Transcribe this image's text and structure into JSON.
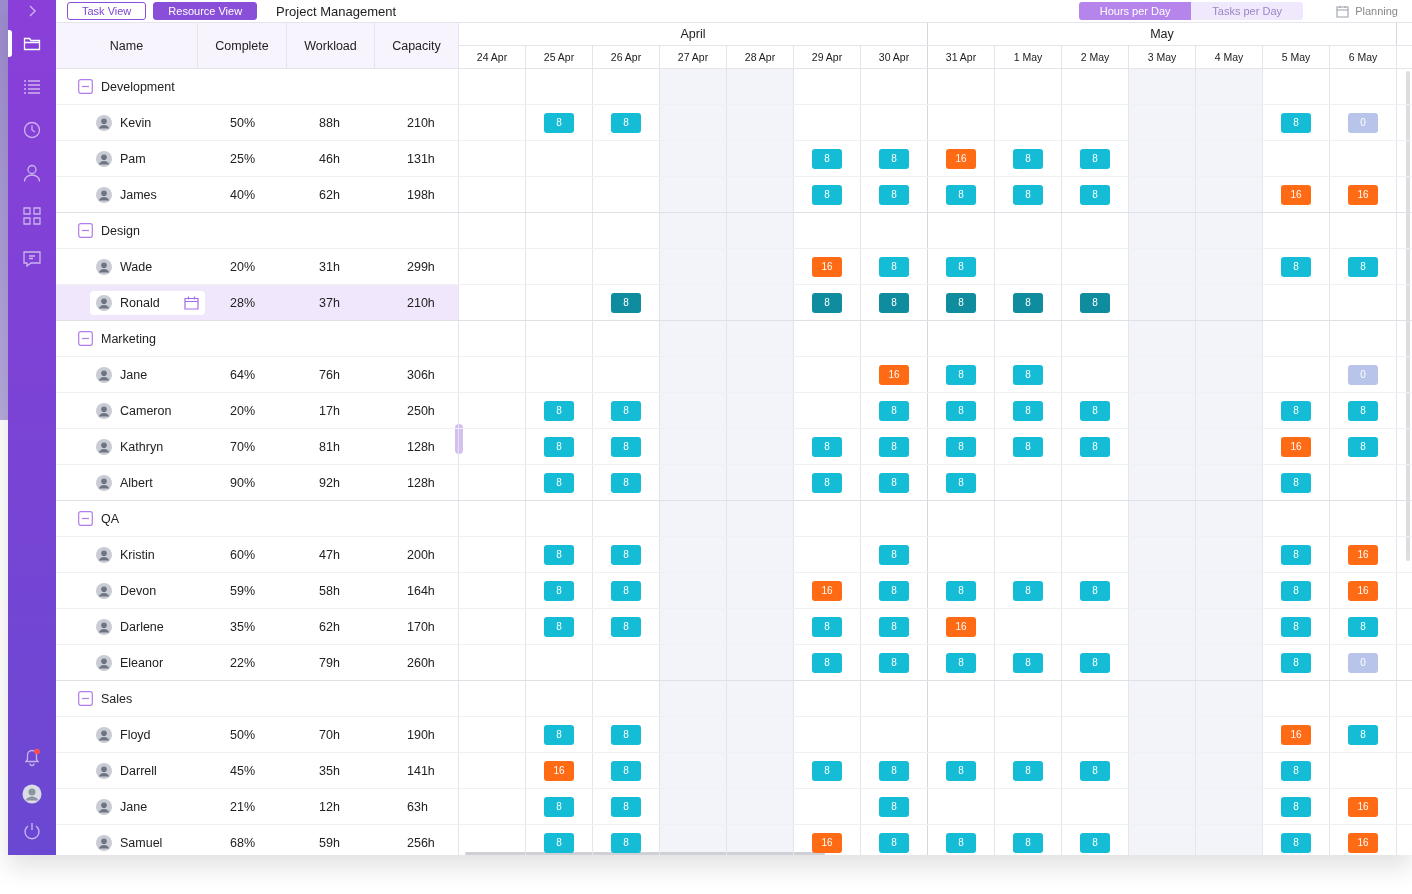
{
  "toolbar": {
    "view_buttons": [
      {
        "label": "Task View",
        "selected": false
      },
      {
        "label": "Resource View",
        "selected": true
      }
    ],
    "title": "Project Management",
    "mode_tabs": [
      {
        "label": "Hours per Day",
        "selected": true
      },
      {
        "label": "Tasks per Day",
        "selected": false
      }
    ],
    "planning_label": "Planning"
  },
  "sidebar": {
    "top_items": [
      {
        "kind": "chevron",
        "selected": false
      },
      {
        "kind": "folder",
        "selected": true
      },
      {
        "kind": "list",
        "selected": false
      },
      {
        "kind": "clock",
        "selected": false
      },
      {
        "kind": "user",
        "selected": false
      },
      {
        "kind": "grid",
        "selected": false
      },
      {
        "kind": "chat",
        "selected": false
      }
    ],
    "bottom_items": [
      {
        "kind": "bell",
        "badge": true
      },
      {
        "kind": "avatar",
        "badge": false
      },
      {
        "kind": "power",
        "badge": false
      }
    ]
  },
  "table": {
    "columns": [
      "Name",
      "Complete",
      "Workload",
      "Capacity"
    ]
  },
  "timeline": {
    "months": [
      {
        "label": "April",
        "days": [
          {
            "label": "24 Apr",
            "weekend": false
          },
          {
            "label": "25 Apr",
            "weekend": false
          },
          {
            "label": "26 Apr",
            "weekend": false
          },
          {
            "label": "27 Apr",
            "weekend": true
          },
          {
            "label": "28 Apr",
            "weekend": true
          },
          {
            "label": "29 Apr",
            "weekend": false
          },
          {
            "label": "30 Apr",
            "weekend": false
          }
        ]
      },
      {
        "label": "May",
        "days": [
          {
            "label": "31 Apr",
            "weekend": false
          },
          {
            "label": "1 May",
            "weekend": false
          },
          {
            "label": "2 May",
            "weekend": false
          },
          {
            "label": "3 May",
            "weekend": true
          },
          {
            "label": "4 May",
            "weekend": true
          },
          {
            "label": "5 May",
            "weekend": false
          },
          {
            "label": "6 May",
            "weekend": false
          }
        ]
      }
    ]
  },
  "groups": [
    {
      "name": "Development",
      "expanded": true,
      "people": [
        {
          "name": "Kevin",
          "complete": "50%",
          "workload": "88h",
          "capacity": "210h",
          "selected": false,
          "cells": [
            {
              "kind": "empty"
            },
            {
              "kind": "normal",
              "hours": "8"
            },
            {
              "kind": "normal",
              "hours": "8"
            },
            {
              "kind": "empty"
            },
            {
              "kind": "empty"
            },
            {
              "kind": "empty"
            },
            {
              "kind": "empty"
            },
            {
              "kind": "empty"
            },
            {
              "kind": "empty"
            },
            {
              "kind": "empty"
            },
            {
              "kind": "empty"
            },
            {
              "kind": "empty"
            },
            {
              "kind": "normal",
              "hours": "8"
            },
            {
              "kind": "zero",
              "hours": "0"
            }
          ]
        },
        {
          "name": "Pam",
          "complete": "25%",
          "workload": "46h",
          "capacity": "131h",
          "selected": false,
          "cells": [
            {
              "kind": "empty"
            },
            {
              "kind": "empty"
            },
            {
              "kind": "empty"
            },
            {
              "kind": "empty"
            },
            {
              "kind": "empty"
            },
            {
              "kind": "normal",
              "hours": "8"
            },
            {
              "kind": "normal",
              "hours": "8"
            },
            {
              "kind": "over",
              "hours": "16"
            },
            {
              "kind": "normal",
              "hours": "8"
            },
            {
              "kind": "normal",
              "hours": "8"
            },
            {
              "kind": "empty"
            },
            {
              "kind": "empty"
            },
            {
              "kind": "empty"
            },
            {
              "kind": "empty"
            }
          ]
        },
        {
          "name": "James",
          "complete": "40%",
          "workload": "62h",
          "capacity": "198h",
          "selected": false,
          "cells": [
            {
              "kind": "empty"
            },
            {
              "kind": "empty"
            },
            {
              "kind": "empty"
            },
            {
              "kind": "empty"
            },
            {
              "kind": "empty"
            },
            {
              "kind": "normal",
              "hours": "8"
            },
            {
              "kind": "normal",
              "hours": "8"
            },
            {
              "kind": "normal",
              "hours": "8"
            },
            {
              "kind": "normal",
              "hours": "8"
            },
            {
              "kind": "normal",
              "hours": "8"
            },
            {
              "kind": "empty"
            },
            {
              "kind": "empty"
            },
            {
              "kind": "over",
              "hours": "16"
            },
            {
              "kind": "over",
              "hours": "16"
            }
          ]
        }
      ]
    },
    {
      "name": "Design",
      "expanded": true,
      "people": [
        {
          "name": "Wade",
          "complete": "20%",
          "workload": "31h",
          "capacity": "299h",
          "selected": false,
          "cells": [
            {
              "kind": "empty"
            },
            {
              "kind": "empty"
            },
            {
              "kind": "empty"
            },
            {
              "kind": "empty"
            },
            {
              "kind": "empty"
            },
            {
              "kind": "over",
              "hours": "16"
            },
            {
              "kind": "normal",
              "hours": "8"
            },
            {
              "kind": "normal",
              "hours": "8"
            },
            {
              "kind": "empty"
            },
            {
              "kind": "empty"
            },
            {
              "kind": "empty"
            },
            {
              "kind": "empty"
            },
            {
              "kind": "normal",
              "hours": "8"
            },
            {
              "kind": "normal",
              "hours": "8"
            }
          ]
        },
        {
          "name": "Ronald",
          "complete": "28%",
          "workload": "37h",
          "capacity": "210h",
          "selected": true,
          "cells": [
            {
              "kind": "empty"
            },
            {
              "kind": "empty"
            },
            {
              "kind": "normal",
              "hours": "8"
            },
            {
              "kind": "empty"
            },
            {
              "kind": "empty"
            },
            {
              "kind": "normal",
              "hours": "8"
            },
            {
              "kind": "normal",
              "hours": "8"
            },
            {
              "kind": "normal",
              "hours": "8"
            },
            {
              "kind": "normal",
              "hours": "8"
            },
            {
              "kind": "normal",
              "hours": "8"
            },
            {
              "kind": "empty"
            },
            {
              "kind": "empty"
            },
            {
              "kind": "empty"
            },
            {
              "kind": "empty"
            }
          ]
        }
      ]
    },
    {
      "name": "Marketing",
      "expanded": true,
      "people": [
        {
          "name": "Jane",
          "complete": "64%",
          "workload": "76h",
          "capacity": "306h",
          "selected": false,
          "cells": [
            {
              "kind": "empty"
            },
            {
              "kind": "empty"
            },
            {
              "kind": "empty"
            },
            {
              "kind": "empty"
            },
            {
              "kind": "empty"
            },
            {
              "kind": "empty"
            },
            {
              "kind": "over",
              "hours": "16"
            },
            {
              "kind": "normal",
              "hours": "8"
            },
            {
              "kind": "normal",
              "hours": "8"
            },
            {
              "kind": "empty"
            },
            {
              "kind": "empty"
            },
            {
              "kind": "empty"
            },
            {
              "kind": "empty"
            },
            {
              "kind": "zero",
              "hours": "0"
            }
          ]
        },
        {
          "name": "Cameron",
          "complete": "20%",
          "workload": "17h",
          "capacity": "250h",
          "selected": false,
          "cells": [
            {
              "kind": "empty"
            },
            {
              "kind": "normal",
              "hours": "8"
            },
            {
              "kind": "normal",
              "hours": "8"
            },
            {
              "kind": "empty"
            },
            {
              "kind": "empty"
            },
            {
              "kind": "empty"
            },
            {
              "kind": "normal",
              "hours": "8"
            },
            {
              "kind": "normal",
              "hours": "8"
            },
            {
              "kind": "normal",
              "hours": "8"
            },
            {
              "kind": "normal",
              "hours": "8"
            },
            {
              "kind": "empty"
            },
            {
              "kind": "empty"
            },
            {
              "kind": "normal",
              "hours": "8"
            },
            {
              "kind": "normal",
              "hours": "8"
            }
          ]
        },
        {
          "name": "Kathryn",
          "complete": "70%",
          "workload": "81h",
          "capacity": "128h",
          "selected": false,
          "cells": [
            {
              "kind": "empty"
            },
            {
              "kind": "normal",
              "hours": "8"
            },
            {
              "kind": "normal",
              "hours": "8"
            },
            {
              "kind": "empty"
            },
            {
              "kind": "empty"
            },
            {
              "kind": "normal",
              "hours": "8"
            },
            {
              "kind": "normal",
              "hours": "8"
            },
            {
              "kind": "normal",
              "hours": "8"
            },
            {
              "kind": "normal",
              "hours": "8"
            },
            {
              "kind": "normal",
              "hours": "8"
            },
            {
              "kind": "empty"
            },
            {
              "kind": "empty"
            },
            {
              "kind": "over",
              "hours": "16"
            },
            {
              "kind": "normal",
              "hours": "8"
            }
          ]
        },
        {
          "name": "Albert",
          "complete": "90%",
          "workload": "92h",
          "capacity": "128h",
          "selected": false,
          "cells": [
            {
              "kind": "empty"
            },
            {
              "kind": "normal",
              "hours": "8"
            },
            {
              "kind": "normal",
              "hours": "8"
            },
            {
              "kind": "empty"
            },
            {
              "kind": "empty"
            },
            {
              "kind": "normal",
              "hours": "8"
            },
            {
              "kind": "normal",
              "hours": "8"
            },
            {
              "kind": "normal",
              "hours": "8"
            },
            {
              "kind": "empty"
            },
            {
              "kind": "empty"
            },
            {
              "kind": "empty"
            },
            {
              "kind": "empty"
            },
            {
              "kind": "normal",
              "hours": "8"
            },
            {
              "kind": "empty"
            }
          ]
        }
      ]
    },
    {
      "name": "QA",
      "expanded": true,
      "people": [
        {
          "name": "Kristin",
          "complete": "60%",
          "workload": "47h",
          "capacity": "200h",
          "selected": false,
          "cells": [
            {
              "kind": "empty"
            },
            {
              "kind": "normal",
              "hours": "8"
            },
            {
              "kind": "normal",
              "hours": "8"
            },
            {
              "kind": "empty"
            },
            {
              "kind": "empty"
            },
            {
              "kind": "empty"
            },
            {
              "kind": "normal",
              "hours": "8"
            },
            {
              "kind": "empty"
            },
            {
              "kind": "empty"
            },
            {
              "kind": "empty"
            },
            {
              "kind": "empty"
            },
            {
              "kind": "empty"
            },
            {
              "kind": "normal",
              "hours": "8"
            },
            {
              "kind": "over",
              "hours": "16"
            }
          ]
        },
        {
          "name": "Devon",
          "complete": "59%",
          "workload": "58h",
          "capacity": "164h",
          "selected": false,
          "cells": [
            {
              "kind": "empty"
            },
            {
              "kind": "normal",
              "hours": "8"
            },
            {
              "kind": "normal",
              "hours": "8"
            },
            {
              "kind": "empty"
            },
            {
              "kind": "empty"
            },
            {
              "kind": "over",
              "hours": "16"
            },
            {
              "kind": "normal",
              "hours": "8"
            },
            {
              "kind": "normal",
              "hours": "8"
            },
            {
              "kind": "normal",
              "hours": "8"
            },
            {
              "kind": "normal",
              "hours": "8"
            },
            {
              "kind": "empty"
            },
            {
              "kind": "empty"
            },
            {
              "kind": "normal",
              "hours": "8"
            },
            {
              "kind": "over",
              "hours": "16"
            }
          ]
        },
        {
          "name": "Darlene",
          "complete": "35%",
          "workload": "62h",
          "capacity": "170h",
          "selected": false,
          "cells": [
            {
              "kind": "empty"
            },
            {
              "kind": "normal",
              "hours": "8"
            },
            {
              "kind": "normal",
              "hours": "8"
            },
            {
              "kind": "empty"
            },
            {
              "kind": "empty"
            },
            {
              "kind": "normal",
              "hours": "8"
            },
            {
              "kind": "normal",
              "hours": "8"
            },
            {
              "kind": "over",
              "hours": "16"
            },
            {
              "kind": "empty"
            },
            {
              "kind": "empty"
            },
            {
              "kind": "empty"
            },
            {
              "kind": "empty"
            },
            {
              "kind": "normal",
              "hours": "8"
            },
            {
              "kind": "normal",
              "hours": "8"
            }
          ]
        },
        {
          "name": "Eleanor",
          "complete": "22%",
          "workload": "79h",
          "capacity": "260h",
          "selected": false,
          "cells": [
            {
              "kind": "empty"
            },
            {
              "kind": "empty"
            },
            {
              "kind": "empty"
            },
            {
              "kind": "empty"
            },
            {
              "kind": "empty"
            },
            {
              "kind": "normal",
              "hours": "8"
            },
            {
              "kind": "normal",
              "hours": "8"
            },
            {
              "kind": "normal",
              "hours": "8"
            },
            {
              "kind": "normal",
              "hours": "8"
            },
            {
              "kind": "normal",
              "hours": "8"
            },
            {
              "kind": "empty"
            },
            {
              "kind": "empty"
            },
            {
              "kind": "normal",
              "hours": "8"
            },
            {
              "kind": "zero",
              "hours": "0"
            }
          ]
        }
      ]
    },
    {
      "name": "Sales",
      "expanded": true,
      "people": [
        {
          "name": "Floyd",
          "complete": "50%",
          "workload": "70h",
          "capacity": "190h",
          "selected": false,
          "cells": [
            {
              "kind": "empty"
            },
            {
              "kind": "normal",
              "hours": "8"
            },
            {
              "kind": "normal",
              "hours": "8"
            },
            {
              "kind": "empty"
            },
            {
              "kind": "empty"
            },
            {
              "kind": "empty"
            },
            {
              "kind": "empty"
            },
            {
              "kind": "empty"
            },
            {
              "kind": "empty"
            },
            {
              "kind": "empty"
            },
            {
              "kind": "empty"
            },
            {
              "kind": "empty"
            },
            {
              "kind": "over",
              "hours": "16"
            },
            {
              "kind": "normal",
              "hours": "8"
            }
          ]
        },
        {
          "name": "Darrell",
          "complete": "45%",
          "workload": "35h",
          "capacity": "141h",
          "selected": false,
          "cells": [
            {
              "kind": "empty"
            },
            {
              "kind": "over",
              "hours": "16"
            },
            {
              "kind": "normal",
              "hours": "8"
            },
            {
              "kind": "empty"
            },
            {
              "kind": "empty"
            },
            {
              "kind": "normal",
              "hours": "8"
            },
            {
              "kind": "normal",
              "hours": "8"
            },
            {
              "kind": "normal",
              "hours": "8"
            },
            {
              "kind": "normal",
              "hours": "8"
            },
            {
              "kind": "normal",
              "hours": "8"
            },
            {
              "kind": "empty"
            },
            {
              "kind": "empty"
            },
            {
              "kind": "normal",
              "hours": "8"
            },
            {
              "kind": "empty"
            }
          ]
        },
        {
          "name": "Jane",
          "complete": "21%",
          "workload": "12h",
          "capacity": "63h",
          "selected": false,
          "cells": [
            {
              "kind": "empty"
            },
            {
              "kind": "normal",
              "hours": "8"
            },
            {
              "kind": "normal",
              "hours": "8"
            },
            {
              "kind": "empty"
            },
            {
              "kind": "empty"
            },
            {
              "kind": "empty"
            },
            {
              "kind": "normal",
              "hours": "8"
            },
            {
              "kind": "empty"
            },
            {
              "kind": "empty"
            },
            {
              "kind": "empty"
            },
            {
              "kind": "empty"
            },
            {
              "kind": "empty"
            },
            {
              "kind": "normal",
              "hours": "8"
            },
            {
              "kind": "over",
              "hours": "16"
            }
          ]
        },
        {
          "name": "Samuel",
          "complete": "68%",
          "workload": "59h",
          "capacity": "256h",
          "selected": false,
          "cells": [
            {
              "kind": "empty"
            },
            {
              "kind": "normal",
              "hours": "8"
            },
            {
              "kind": "normal",
              "hours": "8"
            },
            {
              "kind": "empty"
            },
            {
              "kind": "empty"
            },
            {
              "kind": "over",
              "hours": "16"
            },
            {
              "kind": "normal",
              "hours": "8"
            },
            {
              "kind": "normal",
              "hours": "8"
            },
            {
              "kind": "normal",
              "hours": "8"
            },
            {
              "kind": "normal",
              "hours": "8"
            },
            {
              "kind": "empty"
            },
            {
              "kind": "empty"
            },
            {
              "kind": "normal",
              "hours": "8"
            },
            {
              "kind": "over",
              "hours": "16"
            }
          ]
        }
      ]
    }
  ]
}
